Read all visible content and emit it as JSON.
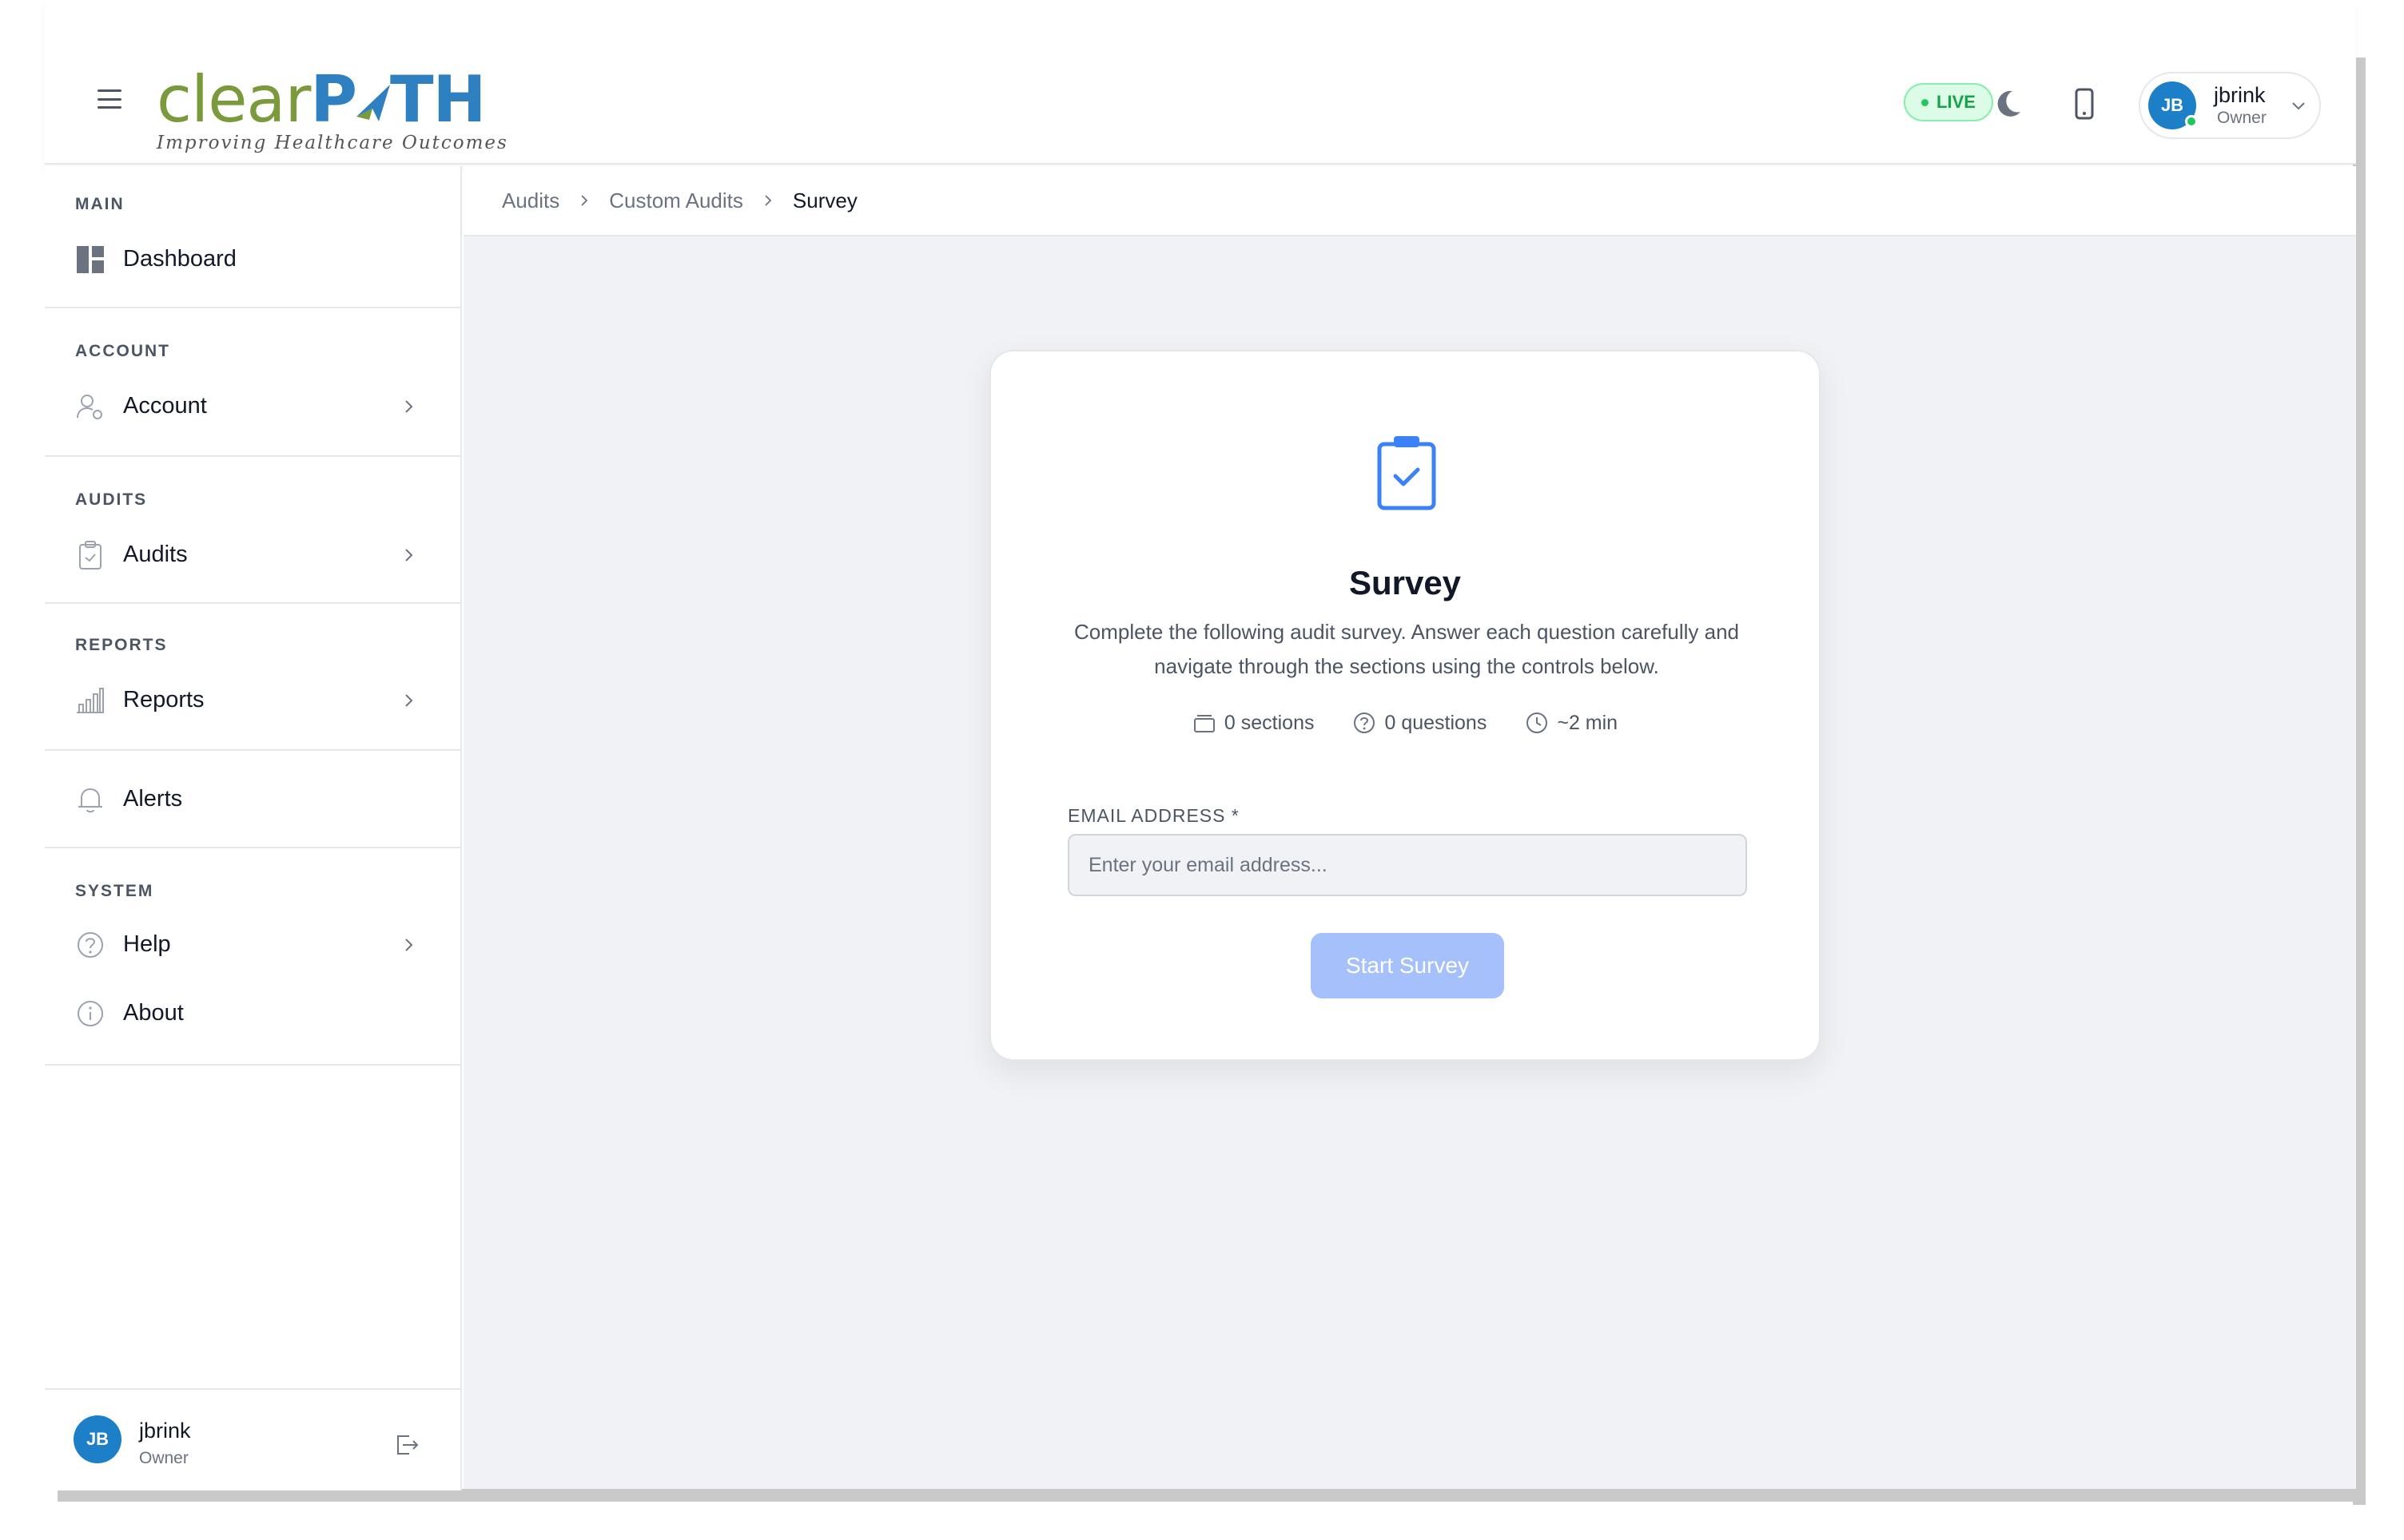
{
  "app": {
    "logo_main_left": "clear",
    "logo_main_right": "P",
    "logo_main_right2": "TH",
    "logo_tagline": "Improving Healthcare Outcomes",
    "brand_green": "#7a9a3c",
    "brand_blue": "#2f80c0"
  },
  "header": {
    "live_label": "LIVE",
    "theme_icon": "moon-icon",
    "device_icon": "mobile-icon",
    "user": {
      "initials": "JB",
      "name": "jbrink",
      "role": "Owner"
    }
  },
  "sidebar": {
    "sections": [
      {
        "title": "MAIN",
        "items": [
          {
            "label": "Dashboard",
            "icon": "dashboard-icon",
            "has_submenu": false
          }
        ]
      },
      {
        "title": "ACCOUNT",
        "items": [
          {
            "label": "Account",
            "icon": "user-settings-icon",
            "has_submenu": true
          }
        ]
      },
      {
        "title": "AUDITS",
        "items": [
          {
            "label": "Audits",
            "icon": "clipboard-check-icon",
            "has_submenu": true
          }
        ]
      },
      {
        "title": "REPORTS",
        "items": [
          {
            "label": "Reports",
            "icon": "bar-chart-icon",
            "has_submenu": true
          }
        ]
      },
      {
        "title": "",
        "items": [
          {
            "label": "Alerts",
            "icon": "bell-icon",
            "has_submenu": false
          }
        ]
      },
      {
        "title": "SYSTEM",
        "items": [
          {
            "label": "Help",
            "icon": "help-circle-icon",
            "has_submenu": true
          },
          {
            "label": "About",
            "icon": "info-circle-icon",
            "has_submenu": false
          }
        ]
      }
    ],
    "footer_user": {
      "initials": "JB",
      "name": "jbrink",
      "role": "Owner"
    }
  },
  "breadcrumb": [
    "Audits",
    "Custom Audits",
    "Survey"
  ],
  "survey": {
    "title": "Survey",
    "description": "Complete the following audit survey. Answer each question carefully and navigate through the sections using the controls below.",
    "meta": {
      "sections": "0 sections",
      "questions": "0 questions",
      "duration": "~2 min"
    },
    "email_label": "EMAIL ADDRESS *",
    "email_placeholder": "Enter your email address...",
    "email_value": "",
    "start_button": "Start Survey",
    "accent": "#3b82f6",
    "button_color": "#a5c0fb"
  },
  "colors": {
    "live_green": "#16a34a",
    "avatar_blue": "#1e7fc9",
    "background": "#f1f2f6"
  }
}
